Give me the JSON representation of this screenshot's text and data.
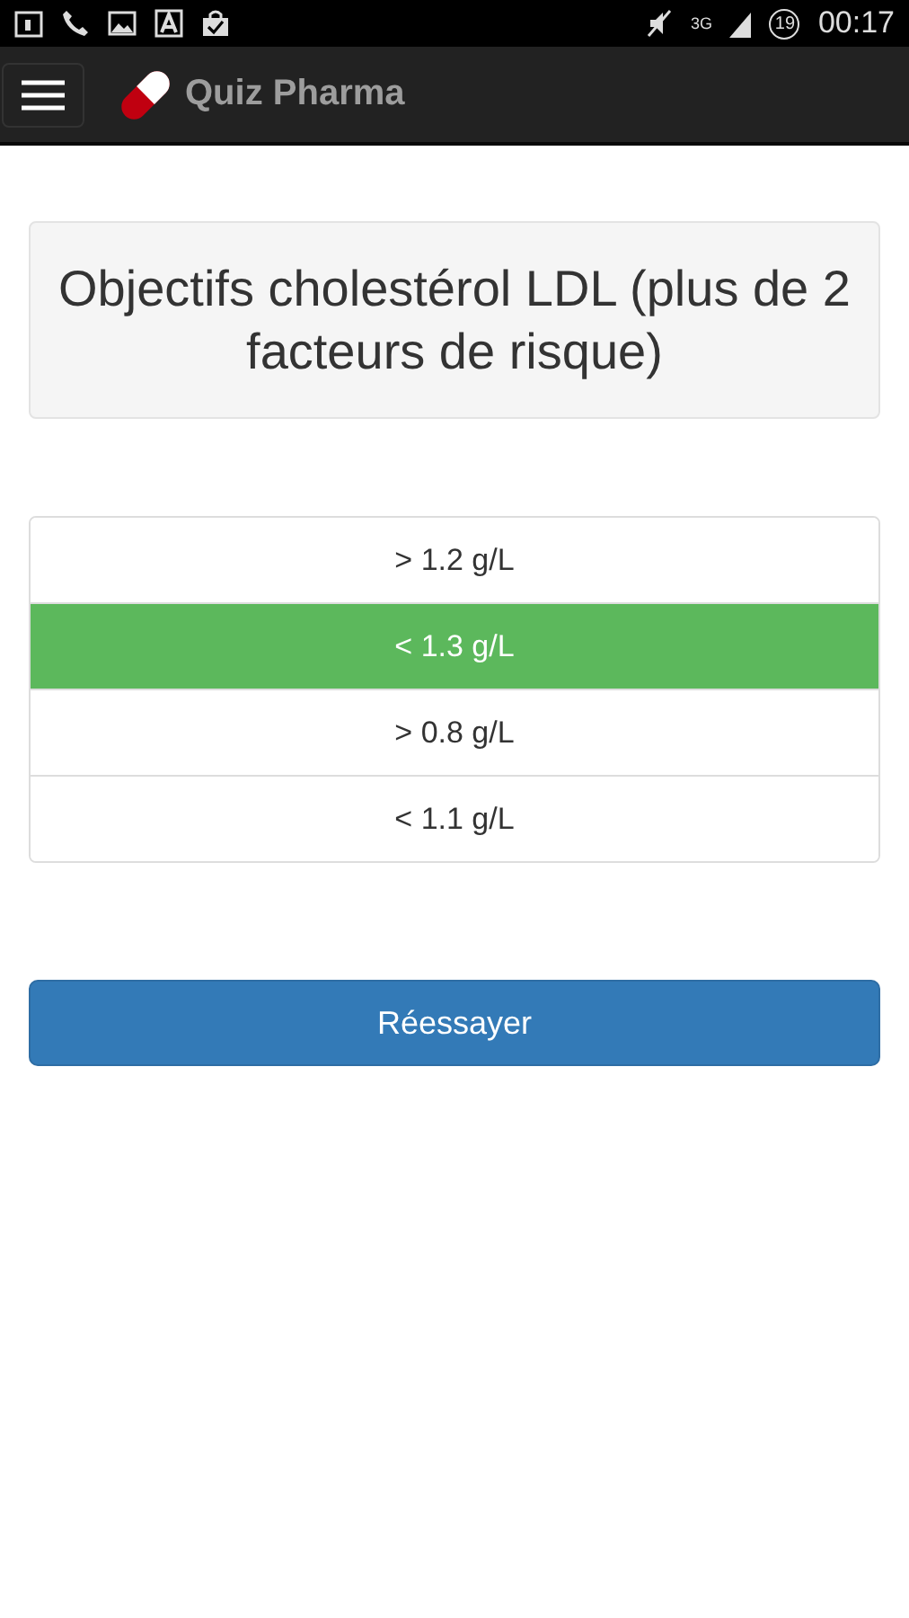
{
  "status_bar": {
    "network": "3G",
    "badge": "19",
    "time": "00:17"
  },
  "app_bar": {
    "title": "Quiz Pharma"
  },
  "question": {
    "title": "Objectifs cholestérol LDL (plus de 2 facteurs de risque)"
  },
  "answers": [
    {
      "label": "> 1.2 g/L",
      "selected": false
    },
    {
      "label": "< 1.3 g/L",
      "selected": true
    },
    {
      "label": "> 0.8 g/L",
      "selected": false
    },
    {
      "label": "< 1.1 g/L",
      "selected": false
    }
  ],
  "retry_button": {
    "label": "Réessayer"
  }
}
